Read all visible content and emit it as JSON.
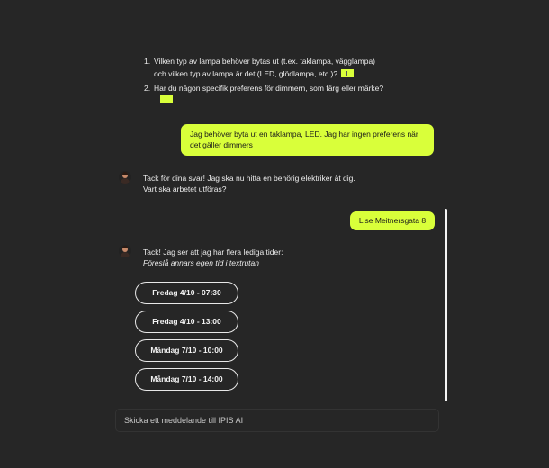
{
  "questions": [
    {
      "number": "1.",
      "lines": [
        "Vilken typ av lampa behöver bytas ut (t.ex. taklampa, vägglampa)",
        "och vilken typ av lampa är det (LED, glödlampa, etc.)?"
      ]
    },
    {
      "number": "2.",
      "lines": [
        "Har du någon specifik preferens för dimmern, som färg eller märke?"
      ]
    }
  ],
  "reply_1": "Jag behöver byta ut en taklampa, LED. Jag har ingen preferens när det gäller dimmers",
  "bot_message_1": {
    "line1": "Tack för dina svar! Jag ska nu hitta en behörig elektriker åt dig.",
    "line2": "Vart ska arbetet utföras?"
  },
  "reply_2": "Lise Meitnersgata 8",
  "bot_message_2": {
    "line1": "Tack! Jag ser att jag har flera lediga tider:",
    "line2": "Föreslå annars egen tid i textrutan"
  },
  "time_slots": [
    "Fredag 4/10 - 07:30",
    "Fredag 4/10 - 13:00",
    "Måndag 7/10 - 10:00",
    "Måndag 7/10 - 14:00"
  ],
  "composer": {
    "placeholder": "Skicka ett meddelande till IPIS AI"
  },
  "colors": {
    "background": "#262626",
    "accent": "#d9ff3a"
  },
  "icons": {
    "bot_avatar": "assistant-avatar",
    "reference_tag": "reference-tag-icon"
  }
}
